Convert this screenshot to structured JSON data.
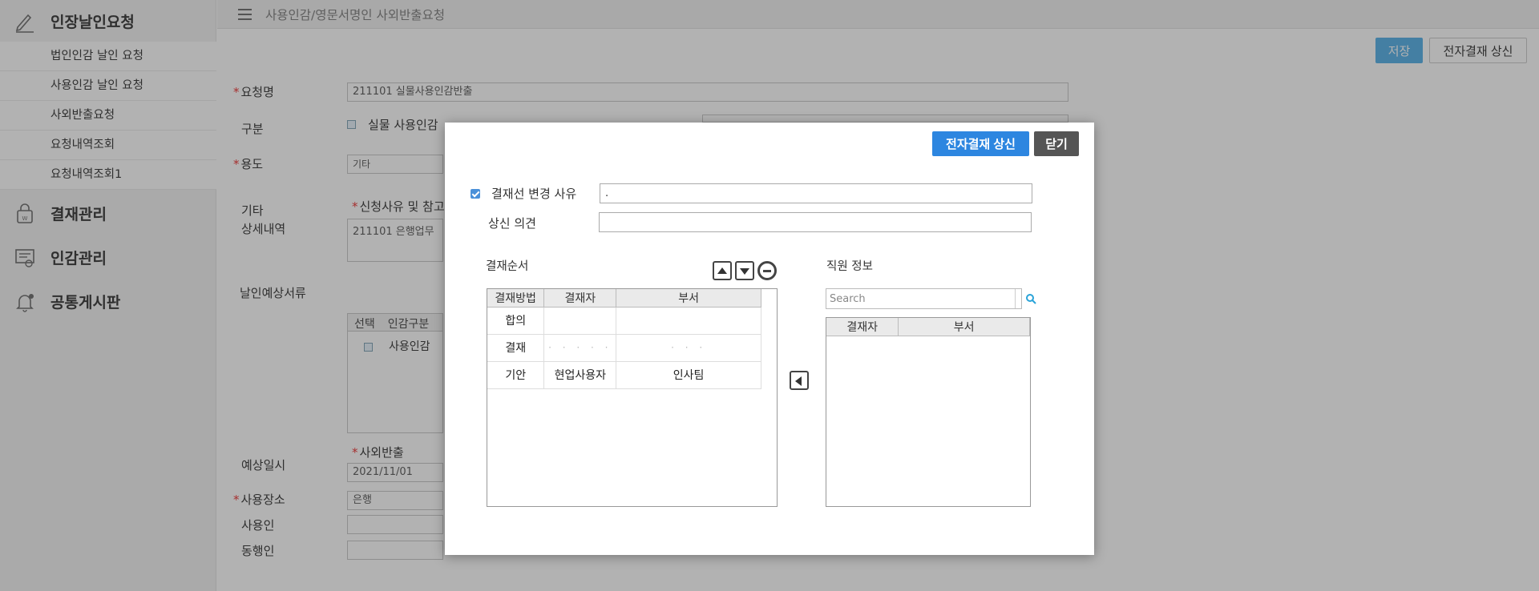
{
  "sidebar": {
    "menus": [
      {
        "label": "인장날인요청",
        "icon": "pen-icon"
      },
      {
        "label": "결재관리",
        "icon": "lock-bag-icon"
      },
      {
        "label": "인감관리",
        "icon": "certificate-icon"
      },
      {
        "label": "공통게시판",
        "icon": "bell-icon"
      }
    ],
    "sub_items": [
      "법인인감 날인 요청",
      "사용인감 날인 요청",
      "사외반출요청",
      "요청내역조회",
      "요청내역조회1"
    ]
  },
  "topbar": {
    "title": "사용인감/영문서명인 사외반출요청"
  },
  "main": {
    "save_label": "저장",
    "approve_label": "전자결재 상신",
    "req_mark": "*",
    "req_name_label": "요청명",
    "req_name_value": "211101 실물사용인감반출",
    "category_label": "구분",
    "category_option": "실물 사용인감",
    "usage_label": "용도",
    "usage_value": "기타",
    "etc_label": "기타",
    "detail_label": "상세내역",
    "reason_label": "신청사유 및 참고",
    "detail_value": "211101 은행업무",
    "docs_label": "날인예상서류",
    "grid_headers": [
      "선택",
      "인감구분"
    ],
    "grid_cell": "사용인감",
    "date_label": "예상일시",
    "export_label": "사외반출",
    "date_value": "2021/11/01",
    "place_label": "사용장소",
    "place_value": "은행",
    "user_label": "사용인",
    "companion_label": "동행인"
  },
  "modal": {
    "approve_label": "전자결재 상신",
    "close_label": "닫기",
    "change_reason_label": "결재선 변경 사유",
    "change_reason_value": ".",
    "opinion_label": "상신 의견",
    "opinion_value": "",
    "order_title": "결재순서",
    "order_headers": [
      "결재방법",
      "결재자",
      "부서"
    ],
    "order_rows": [
      {
        "method": "합의",
        "approver": "",
        "dept": ""
      },
      {
        "method": "결재",
        "approver": "· · ·   · ·",
        "dept": "· · ·"
      },
      {
        "method": "기안",
        "approver": "현업사용자",
        "dept": "인사팀"
      }
    ],
    "staff_title": "직원 정보",
    "search_placeholder": "Search",
    "staff_headers": [
      "결재자",
      "부서"
    ]
  }
}
